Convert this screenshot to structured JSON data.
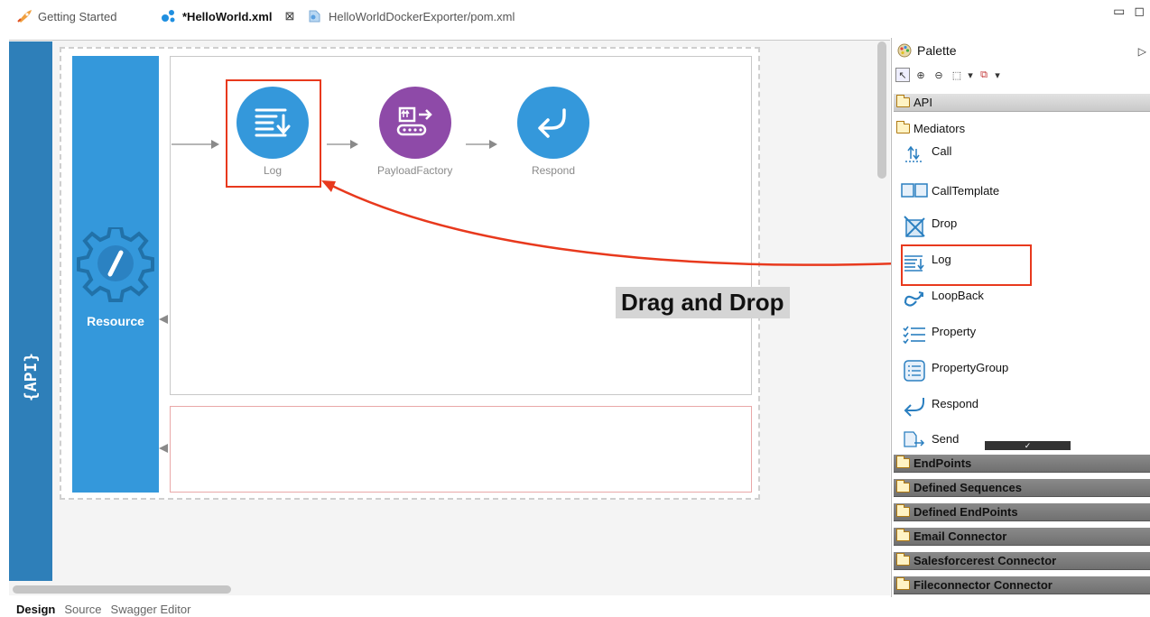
{
  "tabs": [
    {
      "label": "Getting Started",
      "icon": "rocket-icon",
      "active": false
    },
    {
      "label": "*HelloWorld.xml",
      "icon": "api-file-icon",
      "active": true
    },
    {
      "label": "HelloWorldDockerExporter/pom.xml",
      "icon": "maven-file-icon",
      "active": false
    }
  ],
  "canvas": {
    "api_label": "{API}",
    "resource_label": "Resource",
    "mediators": [
      {
        "label": "Log",
        "icon": "log-icon",
        "color": "#3498db"
      },
      {
        "label": "PayloadFactory",
        "icon": "payload-factory-icon",
        "color": "#8e4aa8"
      },
      {
        "label": "Respond",
        "icon": "respond-icon",
        "color": "#3498db"
      }
    ],
    "annotation": "Drag and Drop",
    "annotation_color": "#e8391d"
  },
  "palette": {
    "title": "Palette",
    "drawers_top": [
      {
        "label": "API",
        "icon": "folder-icon"
      },
      {
        "label": "Mediators",
        "icon": "folder-open-icon"
      }
    ],
    "mediator_items": [
      {
        "label": "Call",
        "icon": "call-icon"
      },
      {
        "label": "CallTemplate",
        "icon": "call-template-icon"
      },
      {
        "label": "Drop",
        "icon": "drop-icon"
      },
      {
        "label": "Log",
        "icon": "log-icon"
      },
      {
        "label": "LoopBack",
        "icon": "loopback-icon"
      },
      {
        "label": "Property",
        "icon": "property-icon"
      },
      {
        "label": "PropertyGroup",
        "icon": "property-group-icon"
      },
      {
        "label": "Respond",
        "icon": "respond-icon"
      },
      {
        "label": "Send",
        "icon": "send-icon"
      }
    ],
    "drawers_bottom": [
      {
        "label": "EndPoints"
      },
      {
        "label": "Defined Sequences"
      },
      {
        "label": "Defined EndPoints"
      },
      {
        "label": "Email Connector"
      },
      {
        "label": "Salesforcerest Connector"
      },
      {
        "label": "Fileconnector Connector"
      }
    ]
  },
  "bottom_tabs": [
    {
      "label": "Design",
      "selected": true
    },
    {
      "label": "Source",
      "selected": false
    },
    {
      "label": "Swagger Editor",
      "selected": false
    }
  ]
}
